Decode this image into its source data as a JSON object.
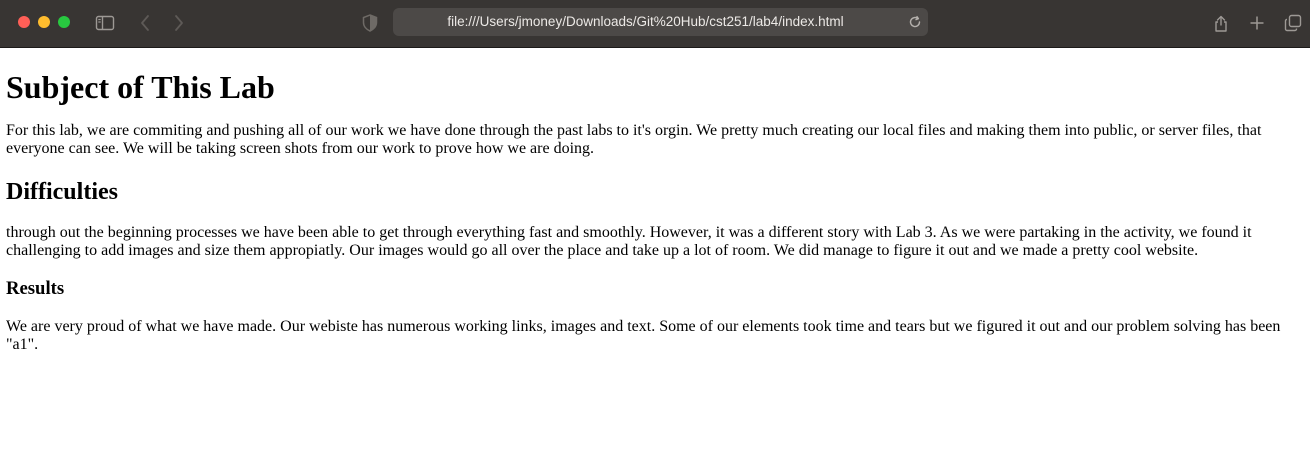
{
  "browser": {
    "url": "file:///Users/jmoney/Downloads/Git%20Hub/cst251/lab4/index.html"
  },
  "page": {
    "heading1": "Subject of This Lab",
    "paragraph1": "For this lab, we are commiting and pushing all of our work we have done through the past labs to it's orgin. We pretty much creating our local files and making them into public, or server files, that everyone can see. We will be taking screen shots from our work to prove how we are doing.",
    "heading2": "Difficulties",
    "paragraph2": "through out the beginning processes we have been able to get through everything fast and smoothly. However, it was a different story with Lab 3. As we were partaking in the activity, we found it challenging to add images and size them appropiatly. Our images would go all over the place and take up a lot of room. We did manage to figure it out and we made a pretty cool website.",
    "heading3": "Results",
    "paragraph3": "We are very proud of what we have made. Our webiste has numerous working links, images and text. Some of our elements took time and tears but we figured it out and our problem solving has been \"a1\"."
  }
}
